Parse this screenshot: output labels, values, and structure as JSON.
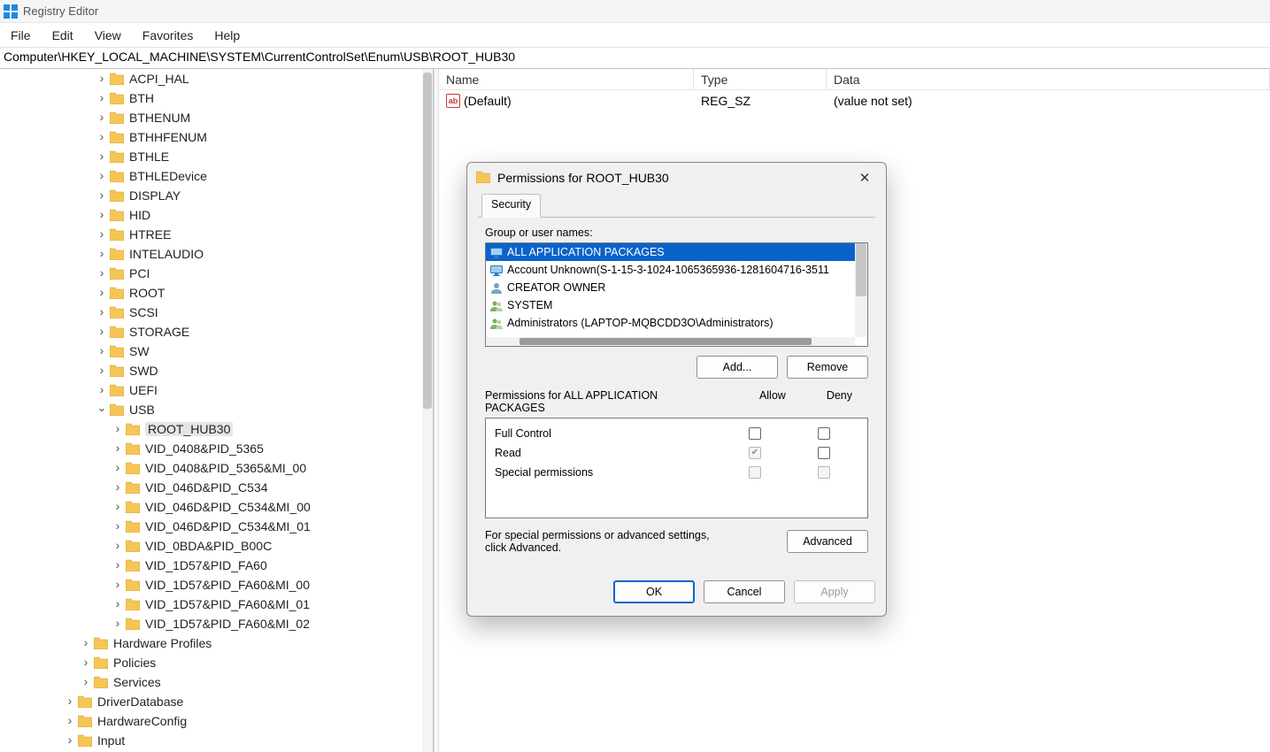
{
  "window": {
    "title": "Registry Editor"
  },
  "menu": [
    "File",
    "Edit",
    "View",
    "Favorites",
    "Help"
  ],
  "address": "Computer\\HKEY_LOCAL_MACHINE\\SYSTEM\\CurrentControlSet\\Enum\\USB\\ROOT_HUB30",
  "tree": {
    "items": [
      {
        "label": "ACPI_HAL",
        "indent": 6,
        "expand": "closed"
      },
      {
        "label": "BTH",
        "indent": 6,
        "expand": "closed"
      },
      {
        "label": "BTHENUM",
        "indent": 6,
        "expand": "closed"
      },
      {
        "label": "BTHHFENUM",
        "indent": 6,
        "expand": "closed"
      },
      {
        "label": "BTHLE",
        "indent": 6,
        "expand": "closed"
      },
      {
        "label": "BTHLEDevice",
        "indent": 6,
        "expand": "closed"
      },
      {
        "label": "DISPLAY",
        "indent": 6,
        "expand": "closed"
      },
      {
        "label": "HID",
        "indent": 6,
        "expand": "closed"
      },
      {
        "label": "HTREE",
        "indent": 6,
        "expand": "closed"
      },
      {
        "label": "INTELAUDIO",
        "indent": 6,
        "expand": "closed"
      },
      {
        "label": "PCI",
        "indent": 6,
        "expand": "closed"
      },
      {
        "label": "ROOT",
        "indent": 6,
        "expand": "closed"
      },
      {
        "label": "SCSI",
        "indent": 6,
        "expand": "closed"
      },
      {
        "label": "STORAGE",
        "indent": 6,
        "expand": "closed"
      },
      {
        "label": "SW",
        "indent": 6,
        "expand": "closed"
      },
      {
        "label": "SWD",
        "indent": 6,
        "expand": "closed"
      },
      {
        "label": "UEFI",
        "indent": 6,
        "expand": "closed"
      },
      {
        "label": "USB",
        "indent": 6,
        "expand": "open"
      },
      {
        "label": "ROOT_HUB30",
        "indent": 7,
        "expand": "closed",
        "selected": true
      },
      {
        "label": "VID_0408&PID_5365",
        "indent": 7,
        "expand": "closed"
      },
      {
        "label": "VID_0408&PID_5365&MI_00",
        "indent": 7,
        "expand": "closed"
      },
      {
        "label": "VID_046D&PID_C534",
        "indent": 7,
        "expand": "closed"
      },
      {
        "label": "VID_046D&PID_C534&MI_00",
        "indent": 7,
        "expand": "closed"
      },
      {
        "label": "VID_046D&PID_C534&MI_01",
        "indent": 7,
        "expand": "closed"
      },
      {
        "label": "VID_0BDA&PID_B00C",
        "indent": 7,
        "expand": "closed"
      },
      {
        "label": "VID_1D57&PID_FA60",
        "indent": 7,
        "expand": "closed"
      },
      {
        "label": "VID_1D57&PID_FA60&MI_00",
        "indent": 7,
        "expand": "closed"
      },
      {
        "label": "VID_1D57&PID_FA60&MI_01",
        "indent": 7,
        "expand": "closed"
      },
      {
        "label": "VID_1D57&PID_FA60&MI_02",
        "indent": 7,
        "expand": "closed"
      },
      {
        "label": "Hardware Profiles",
        "indent": 5,
        "expand": "closed"
      },
      {
        "label": "Policies",
        "indent": 5,
        "expand": "closed"
      },
      {
        "label": "Services",
        "indent": 5,
        "expand": "closed"
      },
      {
        "label": "DriverDatabase",
        "indent": 4,
        "expand": "closed"
      },
      {
        "label": "HardwareConfig",
        "indent": 4,
        "expand": "closed"
      },
      {
        "label": "Input",
        "indent": 4,
        "expand": "closed"
      }
    ]
  },
  "values": {
    "headers": {
      "name": "Name",
      "type": "Type",
      "data": "Data"
    },
    "rows": [
      {
        "name": "(Default)",
        "type": "REG_SZ",
        "data": "(value not set)"
      }
    ]
  },
  "dialog": {
    "title": "Permissions for ROOT_HUB30",
    "tab": "Security",
    "group_label": "Group or user names:",
    "principals": [
      {
        "name": "ALL APPLICATION PACKAGES",
        "icon": "monitor",
        "selected": true
      },
      {
        "name": "Account Unknown(S-1-15-3-1024-1065365936-1281604716-3511",
        "icon": "monitor"
      },
      {
        "name": "CREATOR OWNER",
        "icon": "user"
      },
      {
        "name": "SYSTEM",
        "icon": "users"
      },
      {
        "name": "Administrators (LAPTOP-MQBCDD3O\\Administrators)",
        "icon": "users"
      }
    ],
    "buttons": {
      "add": "Add...",
      "remove": "Remove",
      "advanced": "Advanced",
      "ok": "OK",
      "cancel": "Cancel",
      "apply": "Apply"
    },
    "perm_title": "Permissions for ALL APPLICATION PACKAGES",
    "perm_cols": {
      "allow": "Allow",
      "deny": "Deny"
    },
    "perms": [
      {
        "name": "Full Control",
        "allow": "unchecked",
        "deny": "unchecked"
      },
      {
        "name": "Read",
        "allow": "checked-disabled",
        "deny": "unchecked"
      },
      {
        "name": "Special permissions",
        "allow": "disabled",
        "deny": "disabled"
      }
    ],
    "advanced_text": "For special permissions or advanced settings, click Advanced."
  }
}
